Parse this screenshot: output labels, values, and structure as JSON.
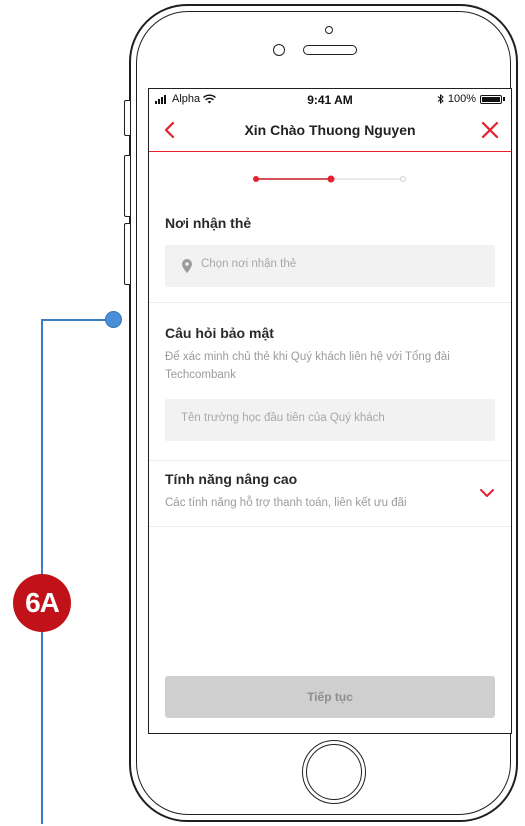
{
  "annotation": {
    "badge_label": "6A"
  },
  "status_bar": {
    "carrier": "Alpha",
    "time": "9:41 AM",
    "battery": "100%"
  },
  "nav": {
    "title": "Xin Chào Thuong Nguyen",
    "back_icon": "chevron-left-icon",
    "close_icon": "close-icon"
  },
  "stepper": {
    "total_steps": 3,
    "current_step": 2
  },
  "card_location": {
    "title": "Nơi nhận thẻ",
    "placeholder": "Chọn nơi nhận thẻ",
    "icon": "location-pin-icon"
  },
  "security": {
    "title": "Câu hỏi bảo mật",
    "description": "Để xác minh chủ thẻ khi Quý khách liên hệ với Tổng đài Techcombank",
    "placeholder": "Tên trường học đầu tiên của Quý khách"
  },
  "advanced": {
    "title": "Tính năng nâng cao",
    "description": "Các tính năng hỗ trợ thanh toán, liên kết ưu đãi",
    "icon": "chevron-down-icon"
  },
  "footer": {
    "continue_label": "Tiếp tục"
  },
  "colors": {
    "accent": "#e6202e",
    "badge": "#c1121a",
    "annotation_line": "#3b7ec4"
  }
}
